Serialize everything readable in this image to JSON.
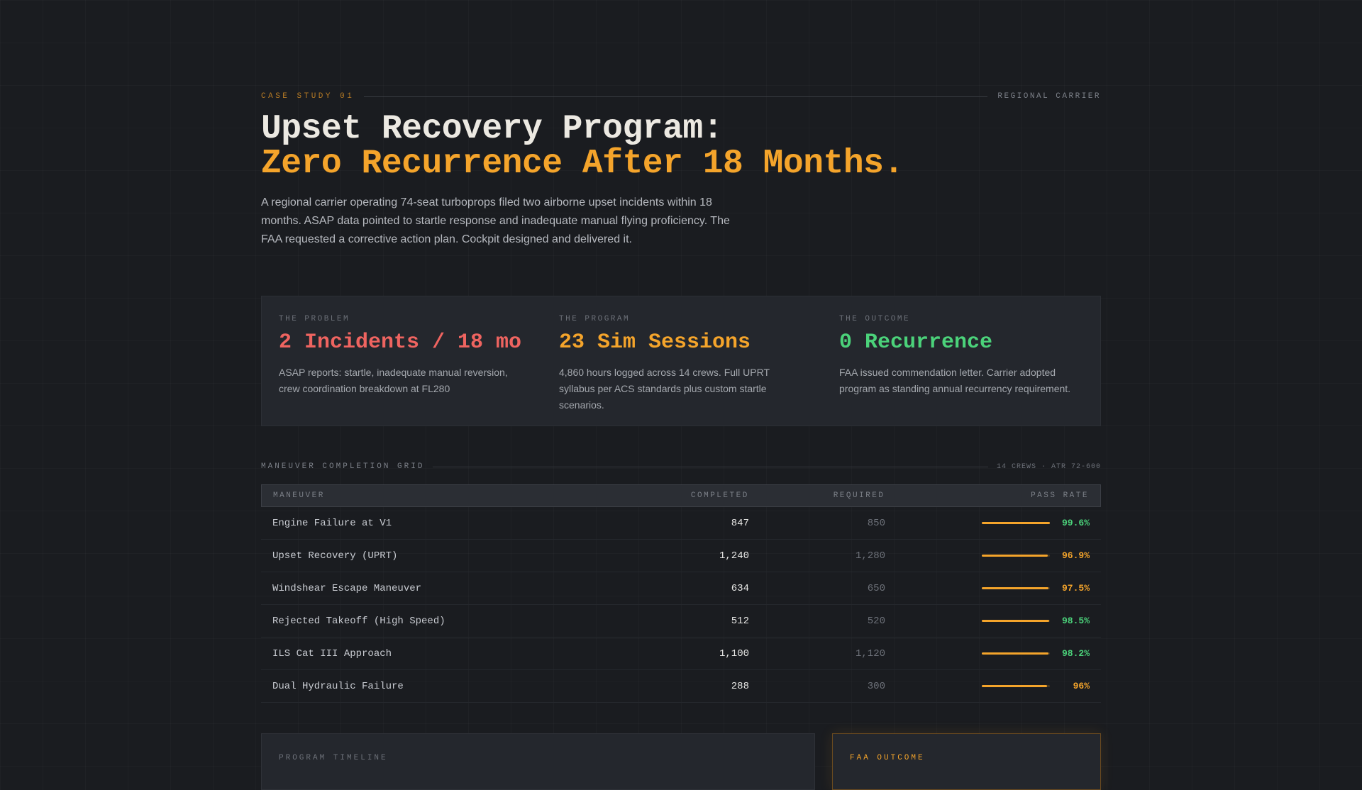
{
  "header": {
    "eyebrow": "CASE STUDY 01",
    "tag": "REGIONAL CARRIER",
    "title_line1": "Upset Recovery Program:",
    "title_line2": "Zero Recurrence After 18 Months.",
    "intro": "A regional carrier operating 74-seat turboprops filed two airborne upset incidents within 18 months. ASAP data pointed to startle response and inadequate manual flying proficiency. The FAA requested a corrective action plan. Cockpit designed and delivered it."
  },
  "stats": [
    {
      "label": "THE PROBLEM",
      "value": "2 Incidents / 18 mo",
      "desc": "ASAP reports: startle, inadequate manual reversion, crew coordination breakdown at FL280",
      "color": "#ef6460"
    },
    {
      "label": "THE PROGRAM",
      "value": "23 Sim Sessions",
      "desc": "4,860 hours logged across 14 crews. Full UPRT syllabus per ACS standards plus custom startle scenarios.",
      "color": "#f4a42b"
    },
    {
      "label": "THE OUTCOME",
      "value": "0 Recurrence",
      "desc": "FAA issued commendation letter. Carrier adopted program as standing annual recurrency requirement.",
      "color": "#4bd27a"
    }
  ],
  "grid": {
    "title": "MANEUVER COMPLETION GRID",
    "meta": "14 CREWS · ATR 72-600",
    "columns": {
      "maneuver": "MANEUVER",
      "completed": "COMPLETED",
      "required": "REQUIRED",
      "pass_rate": "PASS RATE"
    },
    "rows": [
      {
        "maneuver": "Engine Failure at V1",
        "completed": "847",
        "required": "850",
        "pass_rate": "99.6%",
        "rate_value": 99.6,
        "rate_color": "#4bd27a"
      },
      {
        "maneuver": "Upset Recovery (UPRT)",
        "completed": "1,240",
        "required": "1,280",
        "pass_rate": "96.9%",
        "rate_value": 96.9,
        "rate_color": "#f4a42b"
      },
      {
        "maneuver": "Windshear Escape Maneuver",
        "completed": "634",
        "required": "650",
        "pass_rate": "97.5%",
        "rate_value": 97.5,
        "rate_color": "#f4a42b"
      },
      {
        "maneuver": "Rejected Takeoff (High Speed)",
        "completed": "512",
        "required": "520",
        "pass_rate": "98.5%",
        "rate_value": 98.5,
        "rate_color": "#4bd27a"
      },
      {
        "maneuver": "ILS Cat III Approach",
        "completed": "1,100",
        "required": "1,120",
        "pass_rate": "98.2%",
        "rate_value": 98.2,
        "rate_color": "#4bd27a"
      },
      {
        "maneuver": "Dual Hydraulic Failure",
        "completed": "288",
        "required": "300",
        "pass_rate": "96%",
        "rate_value": 96,
        "rate_color": "#f4a42b"
      }
    ]
  },
  "cards": {
    "timeline_label": "PROGRAM TIMELINE",
    "faa_label": "FAA OUTCOME"
  },
  "colors": {
    "accent": "#f4a42b",
    "success": "#4bd27a",
    "danger": "#ef6460",
    "background": "#1a1c20"
  }
}
